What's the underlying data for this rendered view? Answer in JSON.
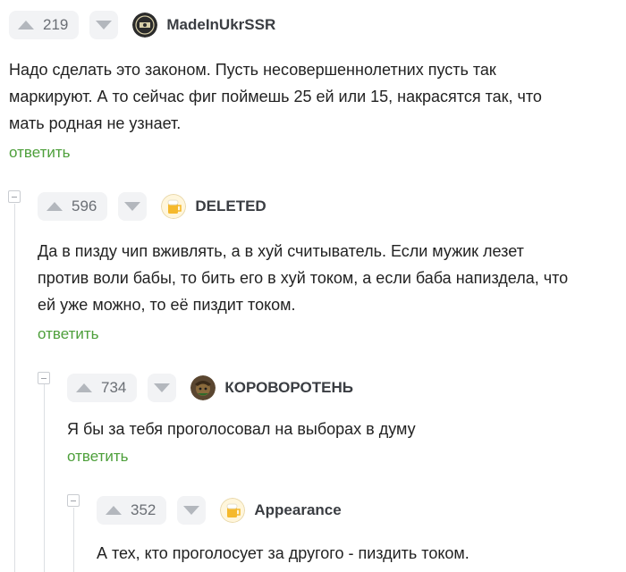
{
  "comments": [
    {
      "score": "219",
      "username": "MadeInUkrSSR",
      "avatar_icon": "stamp-avatar-icon",
      "text_lines": [
        "Надо сделать это законом. Пусть несовершеннолетних пусть так",
        "маркируют. А то сейчас фиг поймешь 25 ей или 15, накрасятся так, что",
        "мать родная не узнает."
      ],
      "reply_label": "ответить"
    },
    {
      "score": "596",
      "username": "DELETED",
      "avatar_icon": "beer-avatar-icon",
      "text_lines": [
        "Да в пизду чип вживлять, а в хуй считыватель. Если мужик лезет",
        "против воли бабы, то бить его в хуй током, а если баба напиздела, что",
        "ей уже можно, то её пиздит током."
      ],
      "reply_label": "ответить"
    },
    {
      "score": "734",
      "username": "КОРОВОРОТЕНЬ",
      "avatar_icon": "character-avatar-icon",
      "text_lines": [
        "Я бы за тебя проголосовал на выборах в думу"
      ],
      "reply_label": "ответить"
    },
    {
      "score": "352",
      "username": "Appearance",
      "avatar_icon": "beer-avatar-icon",
      "text_lines": [
        "А тех, кто проголосует за другого - пиздить током."
      ]
    }
  ],
  "colors": {
    "reply_green": "#4d9f3a",
    "vote_bg": "#f2f3f5",
    "arrow_gray": "#b3b7bd",
    "thread_line": "#dcdfe3"
  }
}
